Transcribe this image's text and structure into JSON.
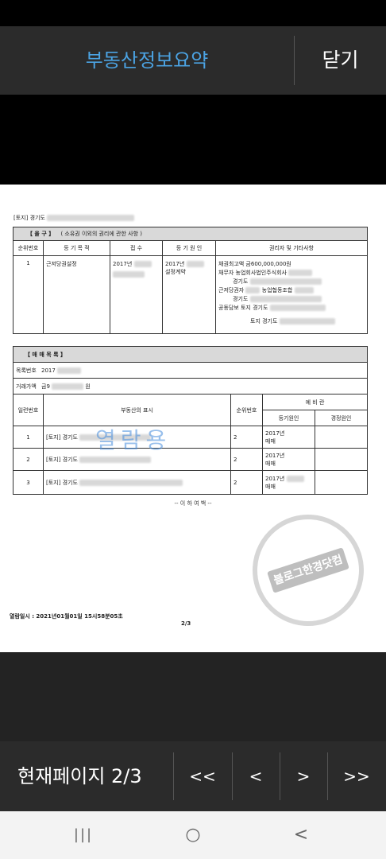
{
  "header": {
    "title": "부동산정보요약",
    "close_label": "닫기"
  },
  "document": {
    "address_label": "[토지] 경기도",
    "section_eul": {
      "title": "【   을      구   】",
      "subtitle": "( 소유권 이외의 권리에 관한 사항 )",
      "columns": [
        "순위번호",
        "등 기 목 적",
        "접    수",
        "등 기 원 인",
        "권리자 및 기타사항"
      ],
      "row": {
        "rank": "1",
        "purpose": "근저당권설정",
        "received": "2017년",
        "cause_year": "2017년",
        "cause": "설정계약",
        "details": [
          "채권최고액   금600,000,000원",
          "채무자  농업회사법인주식회사",
          "경기도",
          "근저당권자",
          "농업협동조합",
          "경기도",
          "공동담보  토지 경기도",
          "토지 경기도"
        ]
      }
    },
    "trade_list": {
      "title": "【 매 매 목 록 】",
      "list_no_label": "목록번호",
      "list_no_value": "2017",
      "price_label": "거래가액",
      "price_prefix": "금9",
      "price_suffix": "원",
      "columns": [
        "일련번호",
        "부동산의 표시",
        "순위번호",
        "예 비 란",
        "등기원인",
        "경정원인"
      ],
      "rows": [
        {
          "serial": "1",
          "property": "[토지] 경기도",
          "rank": "2",
          "cause_year": "2017년",
          "cause": "매매"
        },
        {
          "serial": "2",
          "property": "[토지] 경기도",
          "rank": "2",
          "cause_year": "2017년",
          "cause": "매매"
        },
        {
          "serial": "3",
          "property": "[토지] 경기도",
          "rank": "2",
          "cause_year": "2017년",
          "cause": "매매"
        }
      ]
    },
    "watermark_text": "열람용",
    "stamp_text": "블로그한경닷컴",
    "no_more": "-- 이   하   여   백 --",
    "view_date": "열람일시 :  2021년01월01일  15시58분05초",
    "page_no": "2/3"
  },
  "footer_nav": {
    "current_page": "현재페이지 2/3",
    "first": "<<",
    "prev": "<",
    "next": ">",
    "last": ">>"
  },
  "system_nav": {
    "recent": "|||",
    "home": "○",
    "back": "<"
  }
}
